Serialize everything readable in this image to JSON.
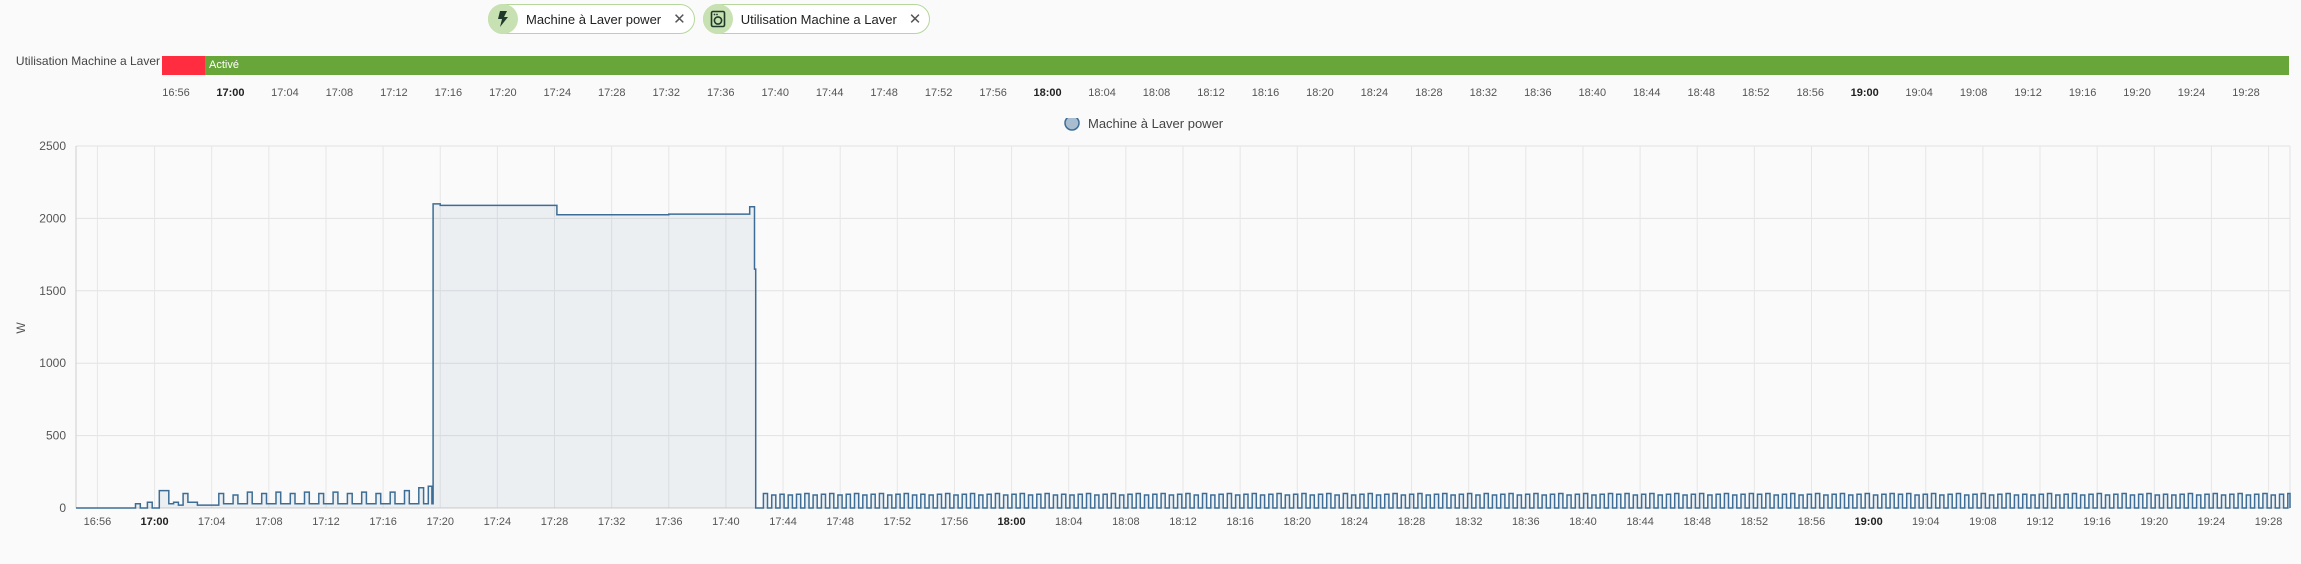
{
  "chips": [
    {
      "label": "Machine à Laver power",
      "icon": "flash-icon"
    },
    {
      "label": "Utilisation Machine a Laver",
      "icon": "washing-machine-icon"
    }
  ],
  "timeline": {
    "entity_label": "Utilisation Machine a Laver",
    "active_label": "Activé",
    "colors": {
      "off": "#ff2d3f",
      "on": "#68a63a"
    },
    "ticks": [
      "16:56",
      "17:00",
      "17:04",
      "17:08",
      "17:12",
      "17:16",
      "17:20",
      "17:24",
      "17:28",
      "17:32",
      "17:36",
      "17:40",
      "17:44",
      "17:48",
      "17:52",
      "17:56",
      "18:00",
      "18:04",
      "18:08",
      "18:12",
      "18:16",
      "18:20",
      "18:24",
      "18:28",
      "18:32",
      "18:36",
      "18:40",
      "18:44",
      "18:48",
      "18:52",
      "18:56",
      "19:00",
      "19:04",
      "19:08",
      "19:12",
      "19:16",
      "19:20",
      "19:24",
      "19:28"
    ]
  },
  "chart_data": {
    "type": "line",
    "series": [
      {
        "name": "Machine à Laver power",
        "color": "#3d6d96"
      }
    ],
    "ylabel": "W",
    "ylim": [
      0,
      2500
    ],
    "yticks": [
      "0",
      "500",
      "1000",
      "1500",
      "2000",
      "2500"
    ],
    "xticks": [
      "16:56",
      "17:00",
      "17:04",
      "17:08",
      "17:12",
      "17:16",
      "17:20",
      "17:24",
      "17:28",
      "17:32",
      "17:36",
      "17:40",
      "17:44",
      "17:48",
      "17:52",
      "17:56",
      "18:00",
      "18:04",
      "18:08",
      "18:12",
      "18:16",
      "18:20",
      "18:24",
      "18:28",
      "18:32",
      "18:36",
      "18:40",
      "18:44",
      "18:48",
      "18:52",
      "18:56",
      "19:00",
      "19:04",
      "19:08",
      "19:12",
      "19:16",
      "19:20",
      "19:24",
      "19:28"
    ],
    "bold_ticks": [
      "17:00",
      "18:00",
      "19:00"
    ],
    "points": [
      [
        "16:54:30",
        0
      ],
      [
        "16:58:30",
        0
      ],
      [
        "16:58:40",
        30
      ],
      [
        "16:59:00",
        0
      ],
      [
        "16:59:30",
        40
      ],
      [
        "16:59:50",
        0
      ],
      [
        "17:00:00",
        0
      ],
      [
        "17:00:20",
        120
      ],
      [
        "17:01:00",
        30
      ],
      [
        "17:01:20",
        40
      ],
      [
        "17:01:40",
        20
      ],
      [
        "17:02:00",
        100
      ],
      [
        "17:02:20",
        40
      ],
      [
        "17:03:00",
        20
      ],
      [
        "17:04:00",
        20
      ],
      [
        "17:04:30",
        100
      ],
      [
        "17:04:50",
        30
      ],
      [
        "17:05:30",
        90
      ],
      [
        "17:05:50",
        30
      ],
      [
        "17:06:30",
        110
      ],
      [
        "17:06:50",
        30
      ],
      [
        "17:07:30",
        100
      ],
      [
        "17:07:50",
        30
      ],
      [
        "17:08:30",
        110
      ],
      [
        "17:08:50",
        30
      ],
      [
        "17:09:30",
        100
      ],
      [
        "17:09:50",
        30
      ],
      [
        "17:10:30",
        110
      ],
      [
        "17:10:50",
        30
      ],
      [
        "17:11:30",
        100
      ],
      [
        "17:11:50",
        30
      ],
      [
        "17:12:30",
        110
      ],
      [
        "17:12:50",
        30
      ],
      [
        "17:13:30",
        100
      ],
      [
        "17:13:50",
        30
      ],
      [
        "17:14:30",
        110
      ],
      [
        "17:14:50",
        30
      ],
      [
        "17:15:30",
        100
      ],
      [
        "17:15:50",
        30
      ],
      [
        "17:16:30",
        110
      ],
      [
        "17:16:50",
        30
      ],
      [
        "17:17:30",
        120
      ],
      [
        "17:17:50",
        30
      ],
      [
        "17:18:30",
        140
      ],
      [
        "17:18:50",
        30
      ],
      [
        "17:19:10",
        150
      ],
      [
        "17:19:25",
        30
      ],
      [
        "17:19:30",
        2100
      ],
      [
        "17:20:00",
        2090
      ],
      [
        "17:28:00",
        2090
      ],
      [
        "17:28:10",
        2025
      ],
      [
        "17:32:00",
        2025
      ],
      [
        "17:32:10",
        2025
      ],
      [
        "17:36:00",
        2030
      ],
      [
        "17:41:30",
        2030
      ],
      [
        "17:41:40",
        2080
      ],
      [
        "17:41:55",
        2080
      ],
      [
        "17:42:00",
        1650
      ],
      [
        "17:42:05",
        0
      ]
    ],
    "idle_from": "17:42:05",
    "idle_to": "19:29:30",
    "idle_levels": [
      0,
      90
    ]
  }
}
